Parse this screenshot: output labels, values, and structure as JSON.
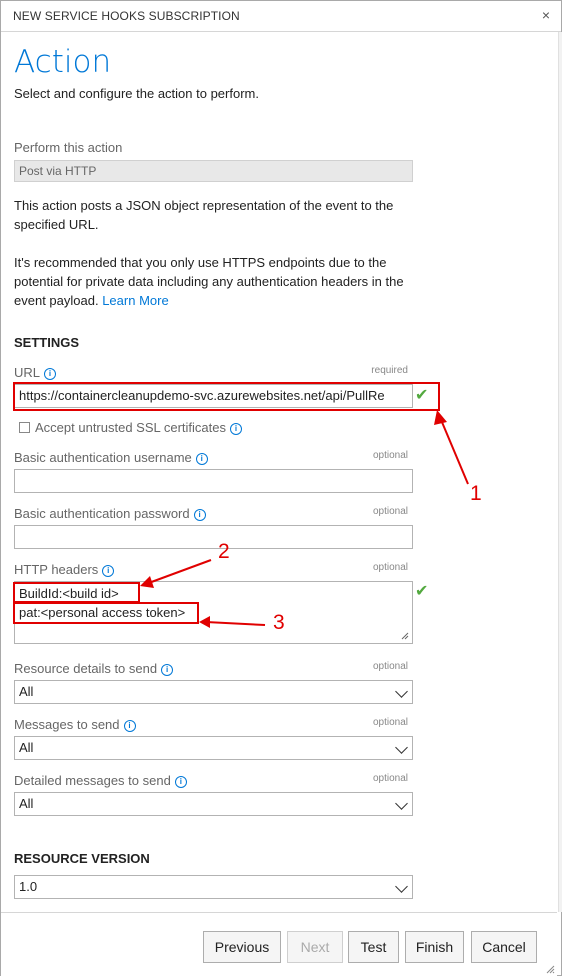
{
  "window": {
    "title": "NEW SERVICE HOOKS SUBSCRIPTION",
    "close_glyph": "×"
  },
  "page": {
    "heading": "Action",
    "subtitle": "Select and configure the action to perform."
  },
  "action": {
    "label": "Perform this action",
    "value": "Post via HTTP",
    "description": "This action posts a JSON object representation of the event to the specified URL.",
    "recommendation": "It's recommended that you only use HTTPS endpoints due to the potential for private data including any authentication headers in the event payload.",
    "learn_more": "Learn More"
  },
  "settings": {
    "heading": "SETTINGS",
    "url": {
      "label": "URL",
      "tag": "required",
      "value": "https://containercleanupdemo-svc.azurewebsites.net/api/PullRe"
    },
    "ssl": {
      "label": "Accept untrusted SSL certificates",
      "checked": false
    },
    "username": {
      "label": "Basic authentication username",
      "tag": "optional",
      "value": ""
    },
    "password": {
      "label": "Basic authentication password",
      "tag": "optional",
      "value": ""
    },
    "headers": {
      "label": "HTTP headers",
      "tag": "optional",
      "lines": [
        "BuildId:<build id>",
        "pat:<personal access token>"
      ]
    },
    "resource_details": {
      "label": "Resource details to send",
      "tag": "optional",
      "value": "All"
    },
    "messages": {
      "label": "Messages to send",
      "tag": "optional",
      "value": "All"
    },
    "detailed_messages": {
      "label": "Detailed messages to send",
      "tag": "optional",
      "value": "All"
    }
  },
  "resource_version": {
    "heading": "RESOURCE VERSION",
    "value": "1.0"
  },
  "annotations": [
    "1",
    "2",
    "3"
  ],
  "footer": {
    "previous": "Previous",
    "next": "Next",
    "test": "Test",
    "finish": "Finish",
    "cancel": "Cancel"
  },
  "colors": {
    "accent": "#0078d7",
    "valid": "#53a93f",
    "annotation": "#e00000"
  }
}
